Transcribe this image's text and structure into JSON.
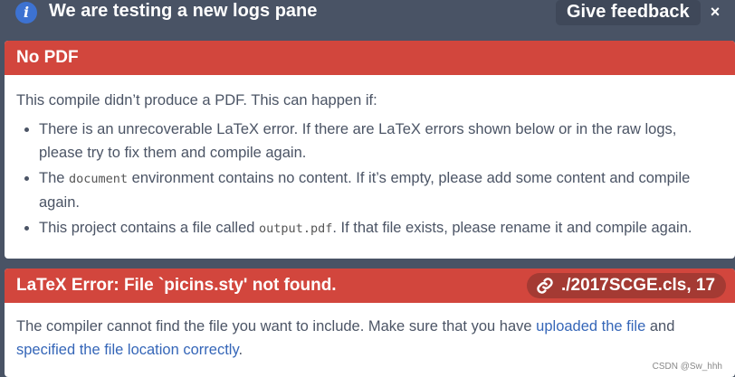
{
  "banner": {
    "text": "We are testing a new logs pane",
    "feedback_label": "Give feedback",
    "close_label": "×",
    "info_label": "i"
  },
  "no_pdf": {
    "title": "No PDF",
    "intro": "This compile didn’t produce a PDF. This can happen if:",
    "item1": "There is an unrecoverable LaTeX error. If there are LaTeX errors shown below or in the raw logs, please try to fix them and compile again.",
    "item2_before": "The ",
    "item2_code": "document",
    "item2_after": " environment contains no content. If it’s empty, please add some content and compile again.",
    "item3_before": "This project contains a file called ",
    "item3_code": "output.pdf",
    "item3_after": ". If that file exists, please rename it and compile again."
  },
  "error": {
    "title": "LaTeX Error: File `picins.sty' not found.",
    "location": "./2017SCGE.cls, 17",
    "body_before": "The compiler cannot find the file you want to include. Make sure that you have ",
    "link1": "uploaded the file",
    "body_mid": " and ",
    "link2": "specified the file location correctly",
    "body_after": "."
  },
  "watermark": "CSDN @Sw_hhh"
}
